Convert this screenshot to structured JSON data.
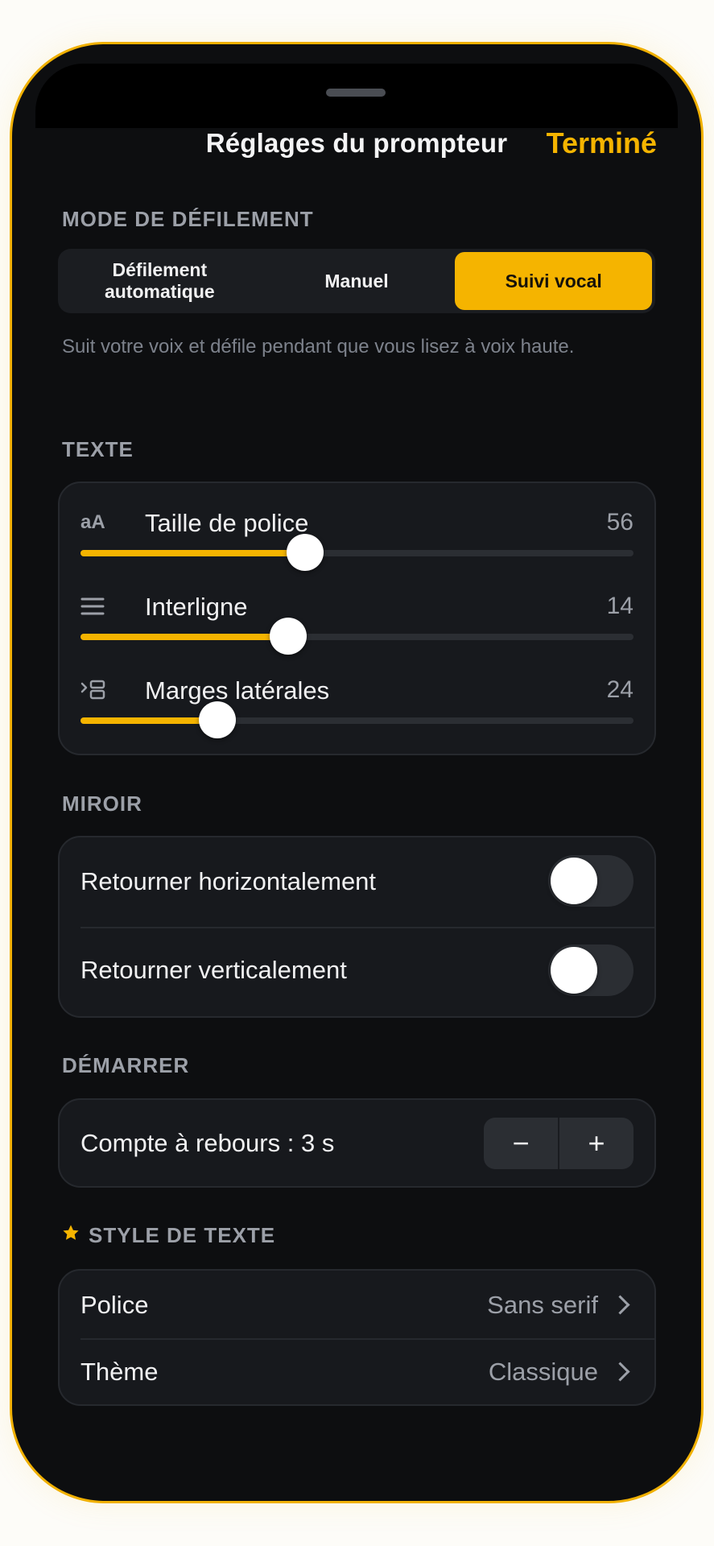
{
  "header": {
    "title": "Réglages du prompteur",
    "done_label": "Terminé"
  },
  "scroll_mode": {
    "section_label": "MODE DE DÉFILEMENT",
    "options": [
      "Défilement\nautomatique",
      "Manuel",
      "Suivi vocal"
    ],
    "selected_index": 2,
    "helper_text": "Suit votre voix et défile pendant que vous lisez à voix haute."
  },
  "text": {
    "section_label": "TEXTE",
    "sliders": [
      {
        "icon": "font-size-icon",
        "label": "Taille de police",
        "value": "56",
        "fraction": 0.406
      },
      {
        "icon": "line-spacing-icon",
        "label": "Interligne",
        "value": "14",
        "fraction": 0.375
      },
      {
        "icon": "side-margins-icon",
        "label": "Marges latérales",
        "value": "24",
        "fraction": 0.248
      }
    ]
  },
  "mirror": {
    "section_label": "MIROIR",
    "flip_horizontal_label": "Retourner horizontalement",
    "flip_horizontal_on": false,
    "flip_vertical_label": "Retourner verticalement",
    "flip_vertical_on": false
  },
  "start": {
    "section_label": "DÉMARRER",
    "countdown_label": "Compte à rebours : 3 s",
    "minus": "−",
    "plus": "+"
  },
  "text_style": {
    "section_label": "STYLE DE TEXTE",
    "font_label": "Police",
    "font_value": "Sans serif",
    "theme_label": "Thème",
    "theme_value": "Classique"
  },
  "colors": {
    "accent": "#f5b400",
    "background": "#0d0e10",
    "card": "#17191d"
  }
}
